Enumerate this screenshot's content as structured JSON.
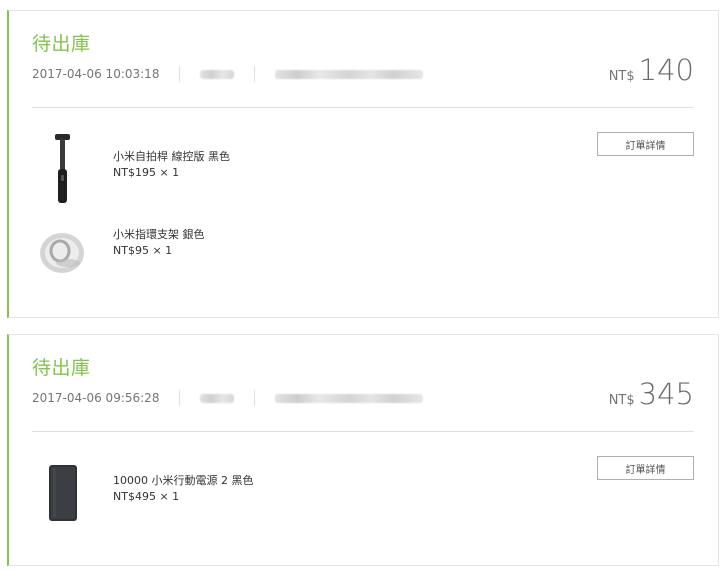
{
  "orders": [
    {
      "status": "待出庫",
      "time": "2017-04-06 10:03:18",
      "total_currency": "NT$",
      "total_amount": "140",
      "detail_button": "訂單詳情",
      "items": [
        {
          "name": "小米自拍桿 線控版 黑色",
          "price": "NT$195 × 1",
          "icon": "selfie-stick-icon"
        },
        {
          "name": "小米指環支架 銀色",
          "price": "NT$95 × 1",
          "icon": "ring-holder-icon"
        }
      ]
    },
    {
      "status": "待出庫",
      "time": "2017-04-06 09:56:28",
      "total_currency": "NT$",
      "total_amount": "345",
      "detail_button": "訂單詳情",
      "items": [
        {
          "name": "10000 小米行動電源 2 黑色",
          "price": "NT$495 × 1",
          "icon": "power-bank-icon"
        }
      ]
    }
  ],
  "colors": {
    "accent": "#83c44e",
    "border": "#e4e4e4",
    "muted_text": "#757575"
  }
}
